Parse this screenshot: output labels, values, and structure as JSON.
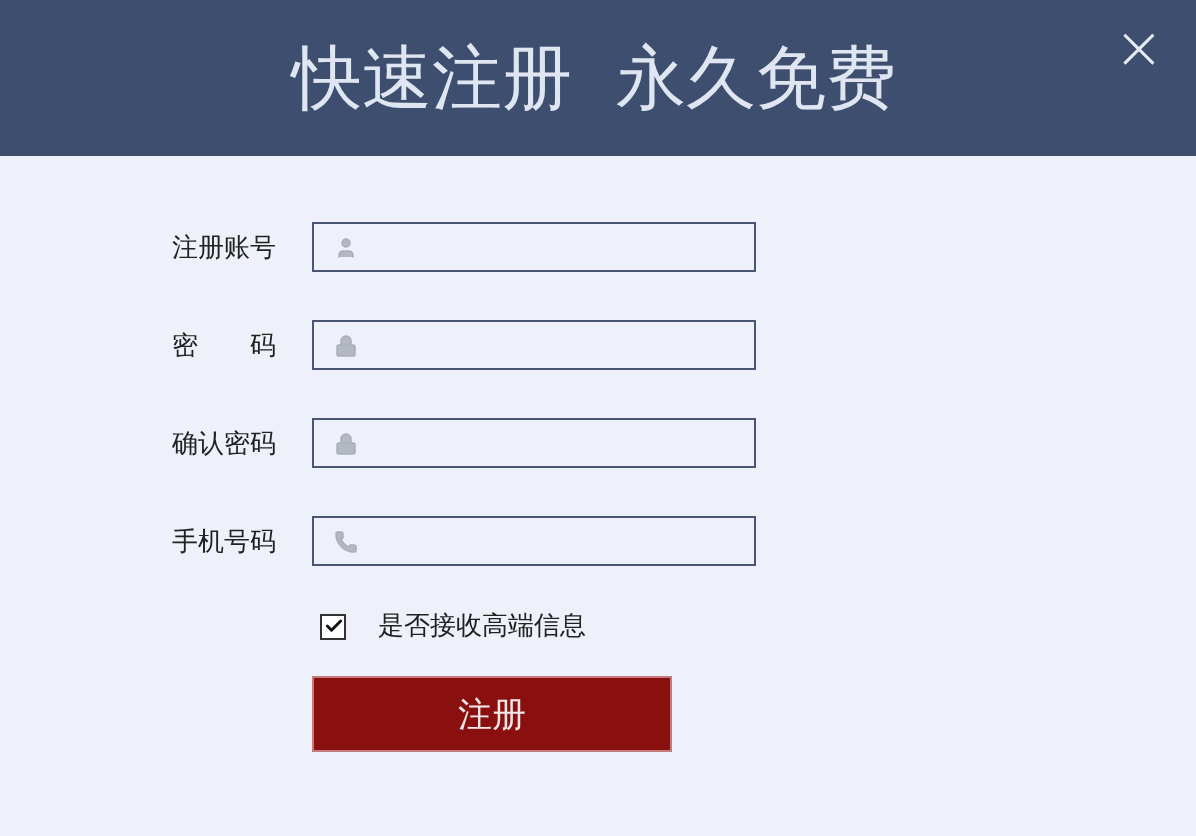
{
  "header": {
    "title": "快速注册  永久免费",
    "close": "×"
  },
  "fields": [
    {
      "label": "注册账号",
      "kind": "user"
    },
    {
      "label": "密　　码",
      "kind": "lock"
    },
    {
      "label": "确认密码",
      "kind": "lock"
    },
    {
      "label": "手机号码",
      "kind": "phone"
    }
  ],
  "consent": {
    "label": "是否接收高端信息",
    "checked": true
  },
  "submit": "注册"
}
